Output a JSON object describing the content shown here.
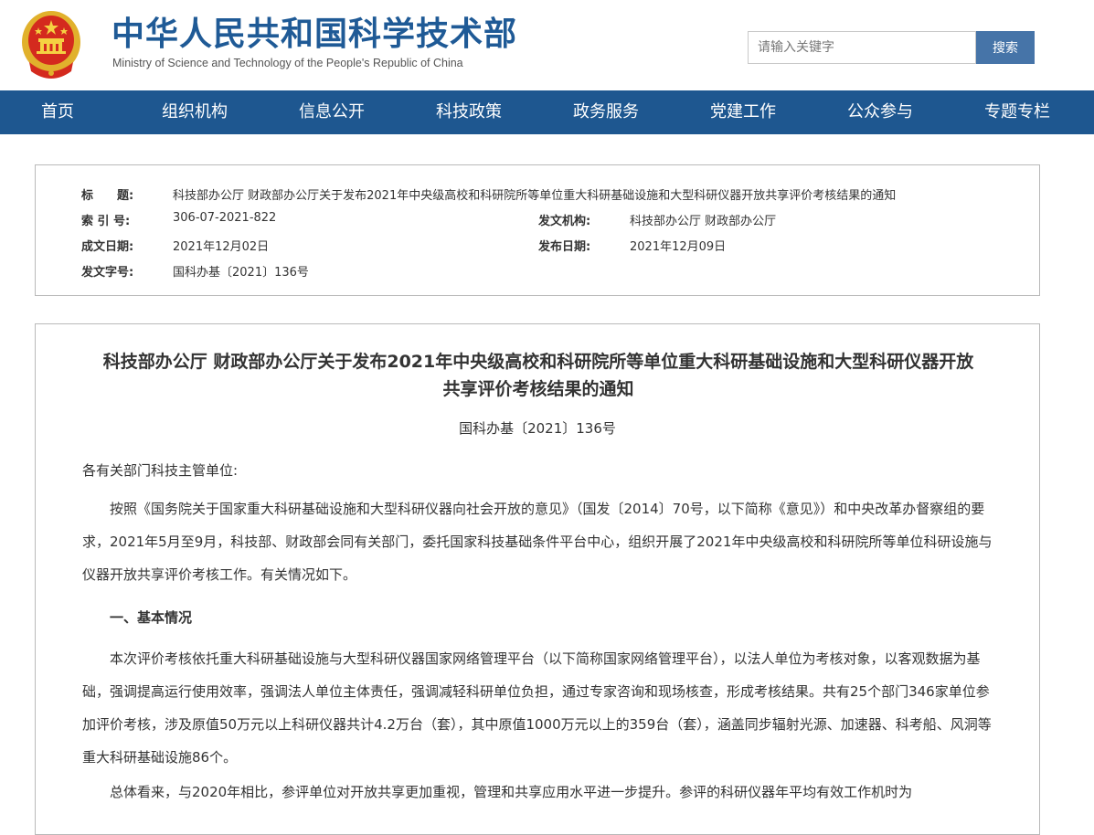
{
  "header": {
    "title": "中华人民共和国科学技术部",
    "subtitle": "Ministry of Science and Technology of the People's Republic of China",
    "search_placeholder": "请输入关键字",
    "search_button": "搜索"
  },
  "nav": {
    "items": [
      "首页",
      "组织机构",
      "信息公开",
      "科技政策",
      "政务服务",
      "党建工作",
      "公众参与",
      "专题专栏"
    ]
  },
  "meta": {
    "title_label": "标　　题:",
    "title_value": "科技部办公厅 财政部办公厅关于发布2021年中央级高校和科研院所等单位重大科研基础设施和大型科研仪器开放共享评价考核结果的通知",
    "index_label": "索 引 号:",
    "index_value": "306-07-2021-822",
    "issuer_label": "发文机构:",
    "issuer_value": "科技部办公厅 财政部办公厅",
    "created_label": "成文日期:",
    "created_value": "2021年12月02日",
    "published_label": "发布日期:",
    "published_value": "2021年12月09日",
    "docno_label": "发文字号:",
    "docno_value": "国科办基〔2021〕136号"
  },
  "doc": {
    "title_line1": "科技部办公厅 财政部办公厅关于发布2021年中央级高校和科研院所等单位重大科研基础设施和大型科研仪器开放",
    "title_line2": "共享评价考核结果的通知",
    "number": "国科办基〔2021〕136号",
    "salutation": "各有关部门科技主管单位:",
    "para1": "按照《国务院关于国家重大科研基础设施和大型科研仪器向社会开放的意见》（国发〔2014〕70号，以下简称《意见》）和中央改革办督察组的要求，2021年5月至9月，科技部、财政部会同有关部门，委托国家科技基础条件平台中心，组织开展了2021年中央级高校和科研院所等单位科研设施与仪器开放共享评价考核工作。有关情况如下。",
    "section1": "一、基本情况",
    "para2": "本次评价考核依托重大科研基础设施与大型科研仪器国家网络管理平台（以下简称国家网络管理平台），以法人单位为考核对象，以客观数据为基础，强调提高运行使用效率，强调法人单位主体责任，强调减轻科研单位负担，通过专家咨询和现场核查，形成考核结果。共有25个部门346家单位参加评价考核，涉及原值50万元以上科研仪器共计4.2万台（套），其中原值1000万元以上的359台（套），涵盖同步辐射光源、加速器、科考船、风洞等重大科研基础设施86个。",
    "para3": "总体看来，与2020年相比，参评单位对开放共享更加重视，管理和共享应用水平进一步提升。参评的科研仪器年平均有效工作机时为"
  },
  "colors": {
    "brand_blue": "#1f5a96",
    "nav_bg": "#1e5790",
    "search_button_bg": "#4674a8"
  }
}
